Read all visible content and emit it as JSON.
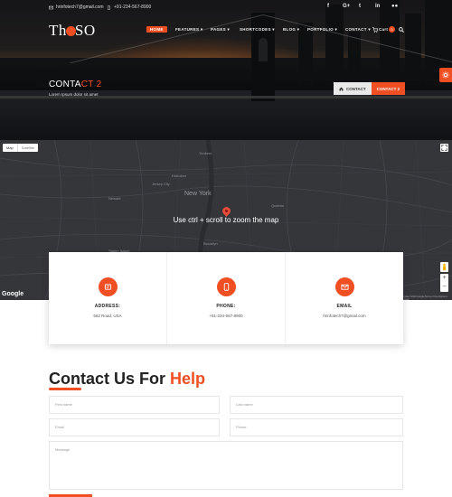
{
  "topbar": {
    "email": "hrinfotech7@gmail.com",
    "phone": "+91-234-567-8900",
    "social_icons": [
      "facebook-icon",
      "google-plus-icon",
      "twitter-icon",
      "linkedin-icon",
      "flickr-icon"
    ]
  },
  "logo": {
    "text_before": "Th",
    "text_after": "SO"
  },
  "nav": {
    "items": [
      {
        "label": "HOME",
        "active": true
      },
      {
        "label": "FEATURES ▾"
      },
      {
        "label": "PAGES ▾"
      },
      {
        "label": "SHORTCODES ▾"
      },
      {
        "label": "BLOG ▾"
      },
      {
        "label": "PORTFOLIO ▾"
      },
      {
        "label": "CONTACT ▾"
      }
    ],
    "cart_label": "Cart",
    "cart_count": "0"
  },
  "hero": {
    "title_main": "CONTA",
    "title_highlight": "CT 2",
    "subtitle": "Lorem Ipsum dolor sit amet",
    "breadcrumb": {
      "home": "CONTACT",
      "current": "CONTACT 2"
    }
  },
  "map": {
    "map_type_map": "Map",
    "map_type_satellite": "Satellite",
    "zoom_message": "Use ctrl + scroll to zoom the map",
    "city_label": "New York",
    "place_labels": [
      "Jersey City",
      "Newark",
      "Hoboken",
      "Brooklyn",
      "Queens",
      "Staten Island",
      "Yonkers"
    ],
    "google_label": "Google",
    "terms": "Map data ©2019 Google  Terms of Use  Report a map error"
  },
  "contact_cards": [
    {
      "icon": "map-marker-icon",
      "title": "ADDRESS:",
      "value": "562 Road, USA"
    },
    {
      "icon": "phone-icon",
      "title": "PHONE:",
      "value": "+91-234-567-8900"
    },
    {
      "icon": "envelope-icon",
      "title": "EMAIL",
      "value": "hrinfotech7@gmail.com"
    }
  ],
  "form": {
    "title_main": "Contact Us For ",
    "title_highlight": "Help",
    "first_name_placeholder": "First name",
    "last_name_placeholder": "Last name",
    "email_placeholder": "Email",
    "phone_placeholder": "Phone",
    "message_placeholder": "Message"
  },
  "colors": {
    "accent": "#f04e23",
    "map_bg": "#34363a"
  }
}
